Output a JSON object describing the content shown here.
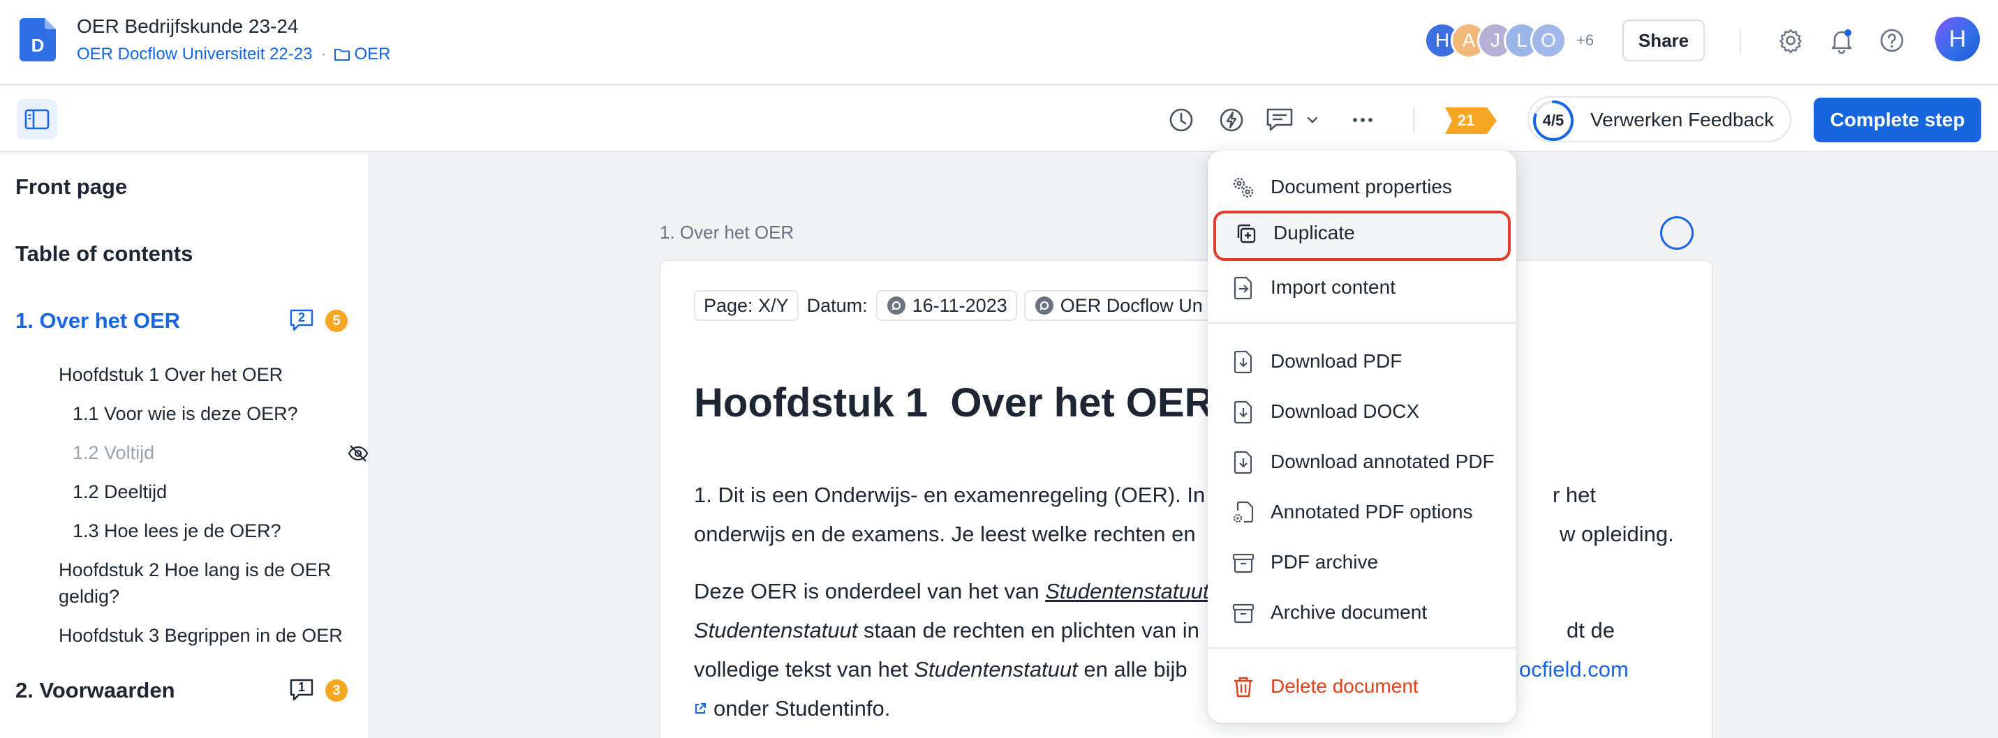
{
  "header": {
    "doc_title": "OER Bedrijfskunde 23-24",
    "breadcrumb_parent": "OER Docflow Universiteit 22-23",
    "breadcrumb_separator": "·",
    "breadcrumb_folder": "OER",
    "avatars": [
      {
        "initial": "H",
        "color": "#3d6fe0"
      },
      {
        "initial": "A",
        "color": "#f0b97a"
      },
      {
        "initial": "J",
        "color": "#b7b0d6"
      },
      {
        "initial": "L",
        "color": "#9bb5e6"
      },
      {
        "initial": "O",
        "color": "#a3b8ea"
      }
    ],
    "avatars_more": "+6",
    "share_label": "Share",
    "user_initial": "H"
  },
  "toolbar": {
    "flag_count": "21",
    "progress": {
      "text": "4/5",
      "completed": 4,
      "total": 5
    },
    "progress_label": "Verwerken Feedback",
    "complete_label": "Complete step"
  },
  "sidebar": {
    "front_page": "Front page",
    "toc": "Table of contents",
    "sections": [
      {
        "label": "1. Over het OER",
        "comments": "2",
        "badge": "5",
        "active": true,
        "items": [
          {
            "label": "Hoofdstuk 1 Over het OER",
            "level": 1
          },
          {
            "label": "1.1 Voor wie is deze OER?",
            "level": 2
          },
          {
            "label": "1.2 Voltijd",
            "level": 2,
            "hidden": true
          },
          {
            "label": "1.2 Deeltijd",
            "level": 2
          },
          {
            "label": "1.3 Hoe lees je de OER?",
            "level": 2
          },
          {
            "label": "Hoofdstuk 2 Hoe lang is de OER geldig?",
            "level": 1
          },
          {
            "label": "Hoofdstuk 3 Begrippen in de OER",
            "level": 1
          }
        ]
      },
      {
        "label": "2. Voorwaarden",
        "comments": "1",
        "badge": "3",
        "active": false
      }
    ]
  },
  "document": {
    "section_label": "1. Over het OER",
    "meta": {
      "page": "Page: X/Y",
      "date_label": "Datum:",
      "date_value": "16-11-2023",
      "org": "OER Docflow Un"
    },
    "heading": "Hoofdstuk 1  Over het OER",
    "p1_line1": "1.  Dit is een Onderwijs- en examenregeling (OER). In",
    "p1_line1_tail": "r het",
    "p1_line2": "onderwijs en de examens. Je leest welke rechten en",
    "p1_line2_tail": "w opleiding.",
    "p2_line1_a": "Deze OER is onderdeel van het van ",
    "p2_line1_b": "Studentenstatuut",
    "p2_line2_a": "Studentenstatuut",
    "p2_line2_b": " staan de rechten en plichten van in",
    "p2_line2_tail": "dt de",
    "p2_line3_a": "volledige tekst van het ",
    "p2_line3_b": "Studentenstatuut",
    "p2_line3_c": " en alle bijb",
    "p2_line3_link": "ocfield.com",
    "p2_line4": "onder Studentinfo."
  },
  "menu": {
    "items": [
      {
        "label": "Document properties",
        "icon": "gears-icon"
      },
      {
        "label": "Duplicate",
        "icon": "duplicate-icon",
        "highlighted": true
      },
      {
        "label": "Import content",
        "icon": "import-icon"
      },
      {
        "label": "Download PDF",
        "icon": "download-file-icon"
      },
      {
        "label": "Download DOCX",
        "icon": "download-file-icon"
      },
      {
        "label": "Download annotated PDF",
        "icon": "download-file-icon"
      },
      {
        "label": "Annotated PDF options",
        "icon": "file-settings-icon"
      },
      {
        "label": "PDF archive",
        "icon": "archive-icon"
      },
      {
        "label": "Archive document",
        "icon": "archive-icon"
      },
      {
        "label": "Delete document",
        "icon": "trash-icon",
        "danger": true
      }
    ]
  },
  "colors": {
    "accent": "#1766e0",
    "danger": "#e0401c",
    "badge": "#f5a623",
    "highlight_border": "#e23b2e"
  }
}
